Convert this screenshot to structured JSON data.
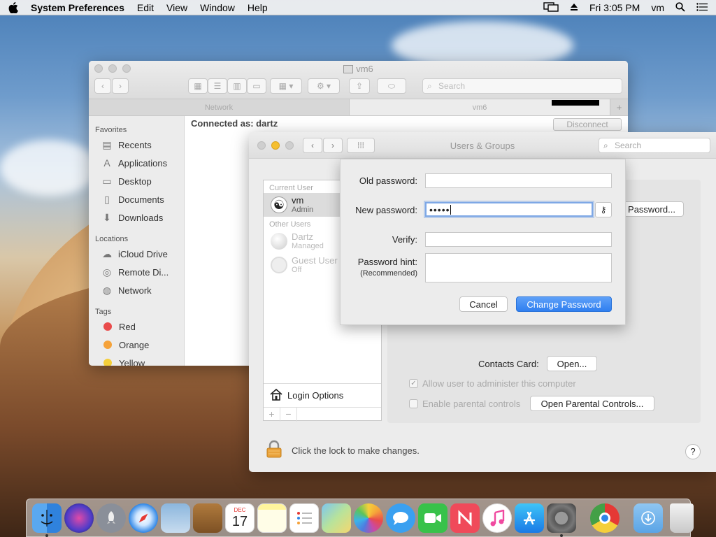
{
  "menubar": {
    "app": "System Preferences",
    "items": [
      "Edit",
      "View",
      "Window",
      "Help"
    ],
    "clock": "Fri 3:05 PM",
    "user": "vm"
  },
  "finder": {
    "title": "vm6",
    "search_placeholder": "Search",
    "tabs": [
      "Network",
      "vm6"
    ],
    "connected_as": "Connected as: dartz",
    "disconnect": "Disconnect",
    "favorites_header": "Favorites",
    "favorites": [
      "Recents",
      "Applications",
      "Desktop",
      "Documents",
      "Downloads"
    ],
    "locations_header": "Locations",
    "locations": [
      "iCloud Drive",
      "Remote Di...",
      "Network"
    ],
    "tags_header": "Tags",
    "tags": [
      {
        "label": "Red",
        "color": "#e94b4b"
      },
      {
        "label": "Orange",
        "color": "#f5a23a"
      },
      {
        "label": "Yellow",
        "color": "#f5cf3a"
      }
    ]
  },
  "prefs": {
    "title": "Users & Groups",
    "search_placeholder": "Search",
    "current_user_header": "Current User",
    "current_user": {
      "name": "vm",
      "role": "Admin"
    },
    "other_users_header": "Other Users",
    "other_users": [
      {
        "name": "Dartz",
        "role": "Managed"
      },
      {
        "name": "Guest User",
        "role": "Off"
      }
    ],
    "login_options": "Login Options",
    "change_password_btn": "Password...",
    "contacts_card_label": "Contacts Card:",
    "open_btn": "Open...",
    "allow_admin": "Allow user to administer this computer",
    "parental": "Enable parental controls",
    "open_parental": "Open Parental Controls...",
    "lock_text": "Click the lock to make changes.",
    "help": "?"
  },
  "sheet": {
    "old_password_label": "Old password:",
    "new_password_label": "New password:",
    "new_password_value": "•••••",
    "verify_label": "Verify:",
    "hint_label": "Password hint:",
    "hint_sub": "(Recommended)",
    "cancel": "Cancel",
    "change": "Change Password"
  },
  "dock": {
    "calendar_month": "DEC",
    "calendar_day": "17"
  }
}
